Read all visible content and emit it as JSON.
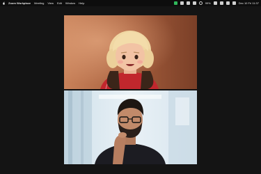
{
  "menubar": {
    "app_name": "Zoom Workplace",
    "items": [
      "Meeting",
      "View",
      "Edit",
      "Window",
      "Help"
    ],
    "battery": "99%",
    "datetime": "Dec 10 Fri 11:37"
  },
  "participants": [
    {
      "id": "top",
      "video": "avatar-woman-blonde"
    },
    {
      "id": "bottom",
      "video": "man-thinking"
    }
  ],
  "colors": {
    "background": "#141414",
    "menubar": "#0d0d0d",
    "status_green": "#2fb85a"
  }
}
